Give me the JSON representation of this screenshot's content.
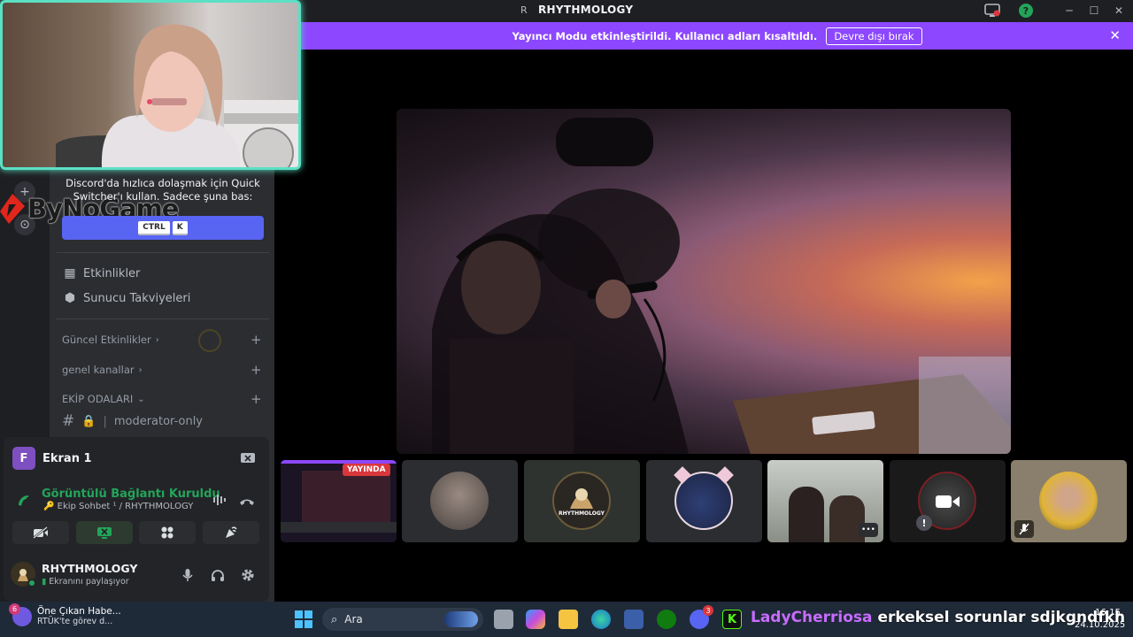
{
  "titlebar": {
    "app_letter": "R",
    "title": "RHYTHMOLOGY"
  },
  "banner": {
    "message": "Yayıncı Modu etkinleştirildi. Kullanıcı adları kısaltıldı.",
    "disable_label": "Devre dışı bırak",
    "close": "✕"
  },
  "sidebar": {
    "tip": "Discord'da hızlıca dolaşmak için Quick Switcher'ı kullan. Sadece şuna bas:",
    "keys": [
      "CTRL",
      "K"
    ],
    "logo_text": "ByNoGame",
    "items": [
      {
        "label": "Etkinlikler",
        "icon": "calendar-icon"
      },
      {
        "label": "Sunucu Takviyeleri",
        "icon": "boost-icon"
      }
    ],
    "categories": [
      {
        "label": "Güncel Etkinlikler",
        "chevron": "›"
      },
      {
        "label": "genel kanallar",
        "chevron": "›"
      },
      {
        "label": "EKİP ODALARI",
        "chevron": "⌄"
      }
    ],
    "channel": {
      "hash": "#",
      "name": "moderator-only"
    }
  },
  "voice": {
    "screen_avatar": "F",
    "screen_name": "Ekran 1",
    "status": "Görüntülü Bağlantı Kuruldu",
    "channel": "🔑 Ekip Sohbet ¹ / RHYTHMOLOGY",
    "user_name": "RHYTHMOLOGY",
    "user_status": "Ekranını paylaşıyor"
  },
  "thumbnails": {
    "live_label": "YAYINDA",
    "server_name": "RHYTHMOLOGY",
    "more": "•••"
  },
  "taskbar": {
    "news_title": "Öne Çıkan Habe...",
    "news_sub": "RTÜK'te görev d...",
    "news_badge": "6",
    "search_placeholder": "Ara",
    "discord_badge": "3",
    "ticker_a": "LadyCherriosa",
    "ticker_b": "erkeksel sorunlar sdjkgndfkh",
    "time": "16:15",
    "date": "24.10.2025"
  },
  "colors": {
    "accent": "#5865f2",
    "banner": "#8c47ff",
    "online": "#23a559",
    "webcam_border": "#5be0c4",
    "live": "#da373c"
  }
}
